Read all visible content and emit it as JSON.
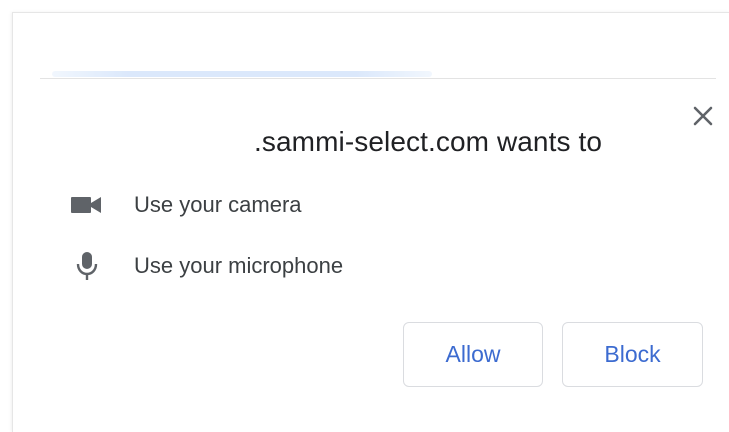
{
  "dialog": {
    "title": ".sammi-select.com wants to",
    "permissions": [
      {
        "icon": "video-camera-icon",
        "label": "Use your camera"
      },
      {
        "icon": "microphone-icon",
        "label": "Use your microphone"
      }
    ],
    "allow_label": "Allow",
    "block_label": "Block"
  },
  "colors": {
    "accent": "#3c6bd0",
    "text": "#202124",
    "icon": "#5f6368",
    "border": "#dadce0"
  }
}
